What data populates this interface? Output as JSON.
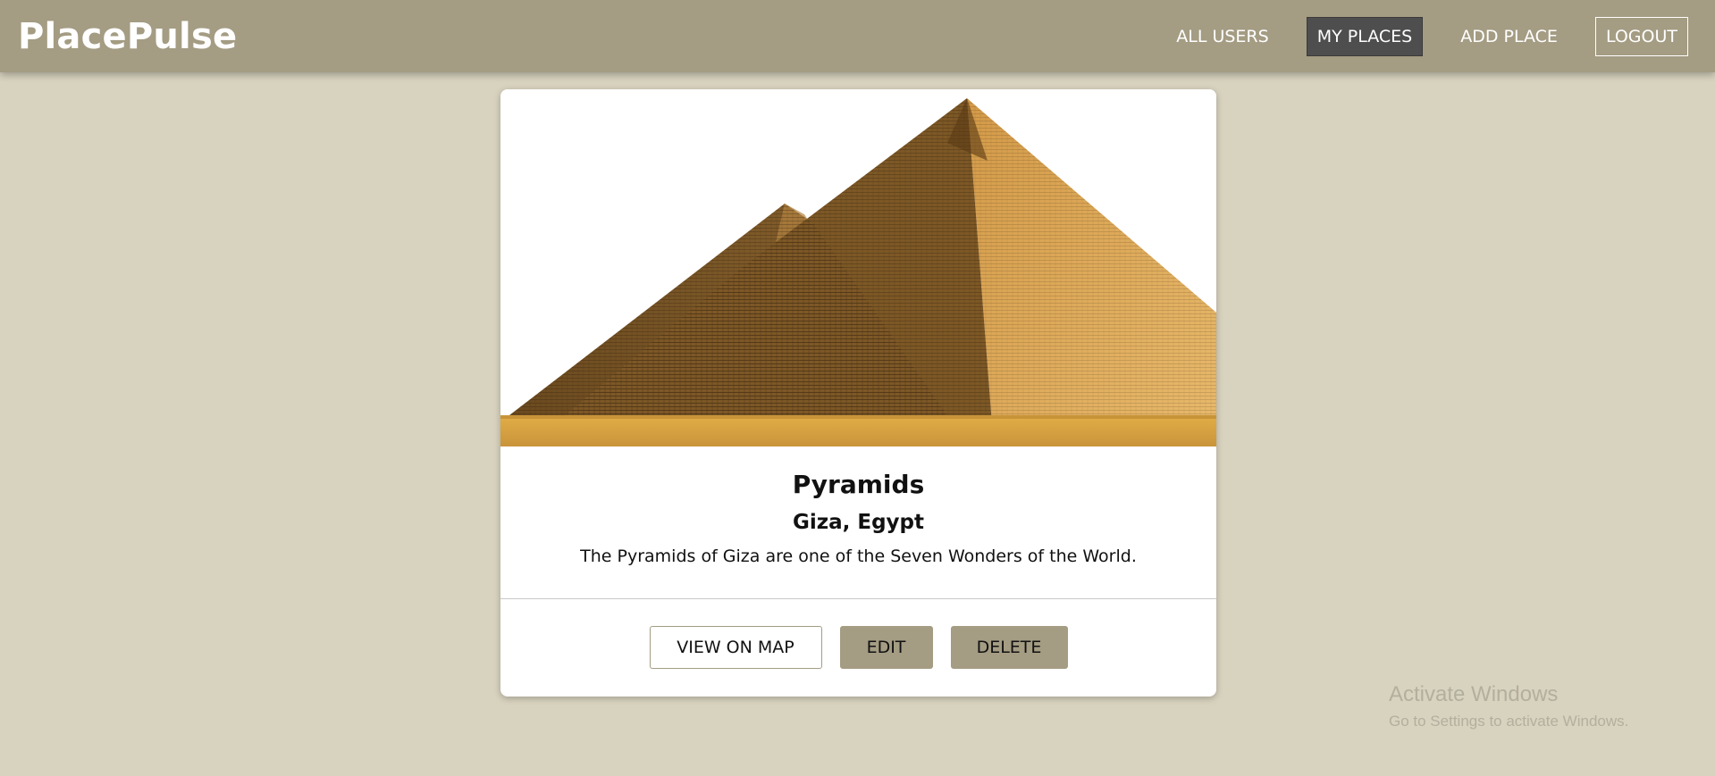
{
  "app": {
    "logo": "PlacePulse"
  },
  "nav": {
    "items": [
      {
        "label": "ALL USERS"
      },
      {
        "label": "MY PLACES",
        "active": true
      },
      {
        "label": "ADD PLACE"
      },
      {
        "label": "LOGOUT"
      }
    ]
  },
  "place": {
    "image_alt": "Pyramids image",
    "title": "Pyramids",
    "address": "Giza, Egypt",
    "description": "The Pyramids of Giza are one of the Seven Wonders of the World."
  },
  "actions": {
    "view_on_map": "VIEW ON MAP",
    "edit": "EDIT",
    "delete": "DELETE"
  },
  "watermark": {
    "title": "Activate Windows",
    "subtitle": "Go to Settings to activate Windows."
  },
  "colors": {
    "header_bg": "#a49c83",
    "page_bg": "#d8d3bf",
    "active_nav_bg": "#4e4e4e",
    "button_fill": "#a49c83"
  }
}
